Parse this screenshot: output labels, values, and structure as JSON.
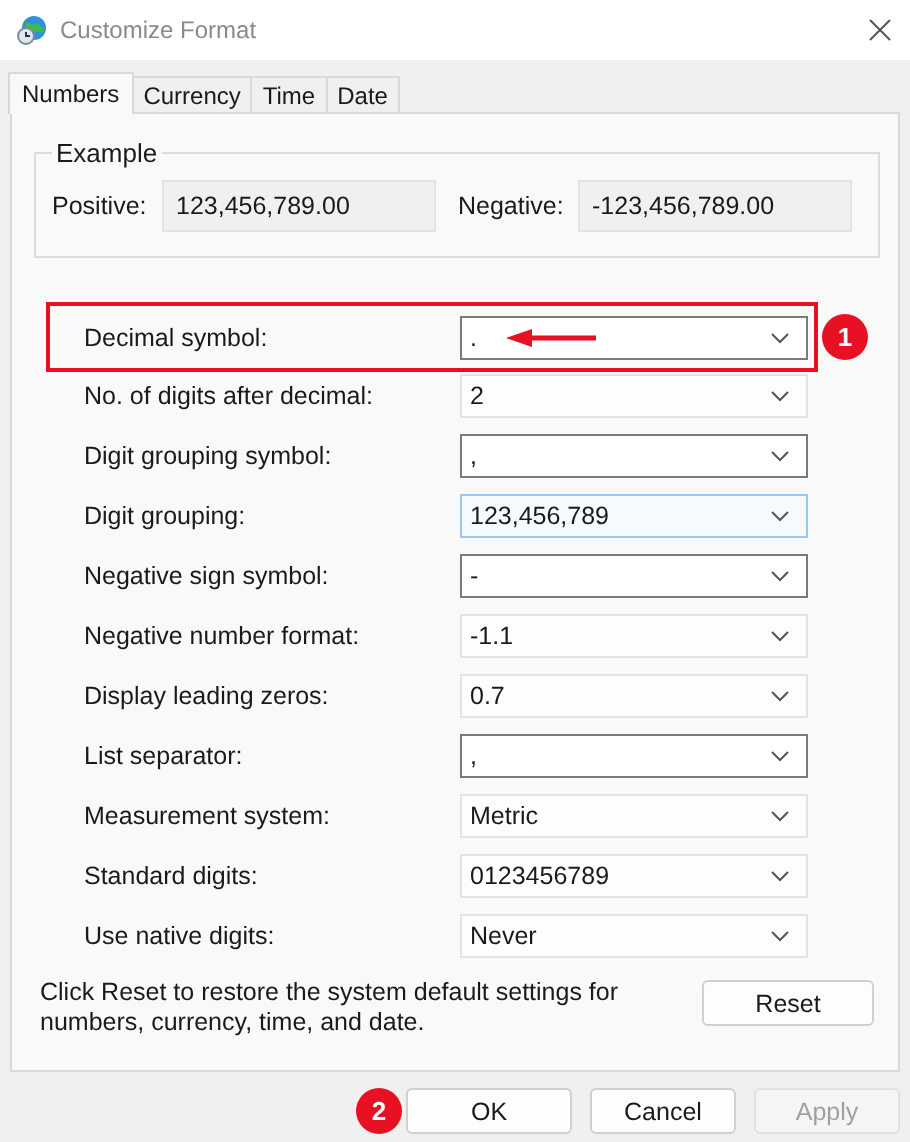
{
  "window": {
    "title": "Customize Format"
  },
  "tabs": [
    {
      "label": "Numbers",
      "selected": true
    },
    {
      "label": "Currency",
      "selected": false
    },
    {
      "label": "Time",
      "selected": false
    },
    {
      "label": "Date",
      "selected": false
    }
  ],
  "example": {
    "title": "Example",
    "positive_label": "Positive:",
    "positive_value": "123,456,789.00",
    "negative_label": "Negative:",
    "negative_value": "-123,456,789.00"
  },
  "settings": [
    {
      "label": "Decimal symbol:",
      "value": ".",
      "kind": "editable",
      "focused": false,
      "highlighted": true,
      "arrow": true,
      "callout": "1"
    },
    {
      "label": "No. of digits after decimal:",
      "value": "2",
      "kind": "list",
      "focused": false,
      "highlighted": false,
      "arrow": false
    },
    {
      "label": "Digit grouping symbol:",
      "value": ",",
      "kind": "editable",
      "focused": false,
      "highlighted": false,
      "arrow": false
    },
    {
      "label": "Digit grouping:",
      "value": "123,456,789",
      "kind": "list",
      "focused": true,
      "highlighted": false,
      "arrow": false
    },
    {
      "label": "Negative sign symbol:",
      "value": "-",
      "kind": "editable",
      "focused": false,
      "highlighted": false,
      "arrow": false
    },
    {
      "label": "Negative number format:",
      "value": "-1.1",
      "kind": "list",
      "focused": false,
      "highlighted": false,
      "arrow": false
    },
    {
      "label": "Display leading zeros:",
      "value": "0.7",
      "kind": "list",
      "focused": false,
      "highlighted": false,
      "arrow": false
    },
    {
      "label": "List separator:",
      "value": ",",
      "kind": "editable",
      "focused": false,
      "highlighted": false,
      "arrow": false
    },
    {
      "label": "Measurement system:",
      "value": "Metric",
      "kind": "list",
      "focused": false,
      "highlighted": false,
      "arrow": false
    },
    {
      "label": "Standard digits:",
      "value": "0123456789",
      "kind": "list",
      "focused": false,
      "highlighted": false,
      "arrow": false
    },
    {
      "label": "Use native digits:",
      "value": "Never",
      "kind": "list",
      "focused": false,
      "highlighted": false,
      "arrow": false
    }
  ],
  "reset_note": "Click Reset to restore the system default settings for numbers, currency, time, and date.",
  "reset_button": "Reset",
  "buttons": [
    {
      "label": "OK",
      "disabled": false,
      "callout": "2"
    },
    {
      "label": "Cancel",
      "disabled": false
    },
    {
      "label": "Apply",
      "disabled": true
    }
  ]
}
